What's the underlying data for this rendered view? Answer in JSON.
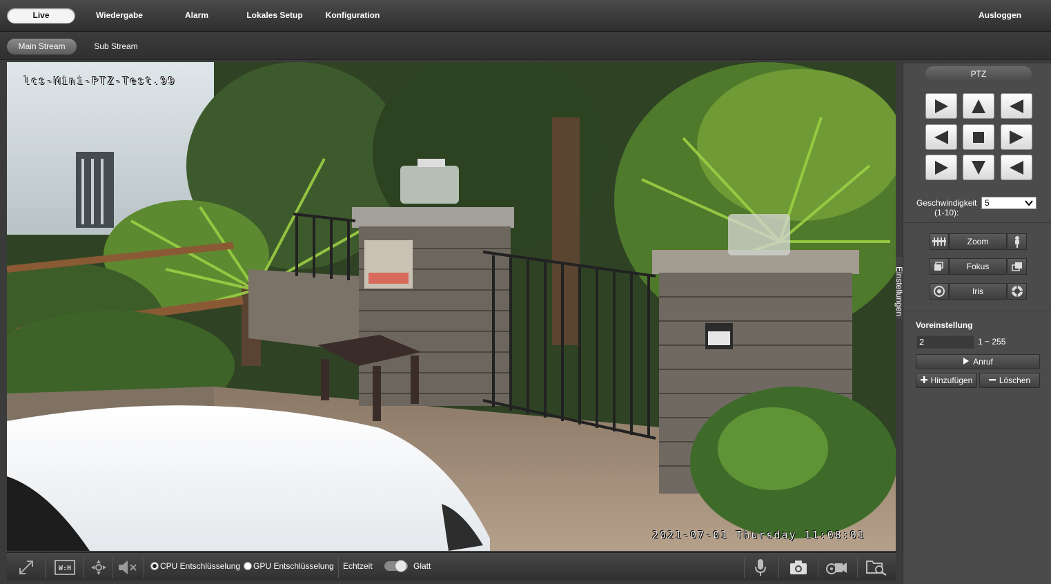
{
  "topnav": {
    "tabs": [
      {
        "label": "Live",
        "active": true
      },
      {
        "label": "Wiedergabe"
      },
      {
        "label": "Alarm"
      },
      {
        "label": "Lokales Setup"
      },
      {
        "label": "Konfiguration"
      }
    ],
    "logout": "Ausloggen"
  },
  "subnav": {
    "tabs": [
      {
        "label": "Main Stream",
        "active": true
      },
      {
        "label": "Sub Stream"
      }
    ]
  },
  "video": {
    "osd_name": "lcs-Mini-PTZ-Test.99",
    "osd_time": "2021-07-01 Thursday 11:08:01"
  },
  "toolbar": {
    "cpu_decode": "CPU Entschlüsselung",
    "gpu_decode": "GPU Entschlüsselung",
    "realtime": "Echtzeit",
    "smooth": "Glatt",
    "decode_selected": "CPU"
  },
  "sidetab": "Einstellungen",
  "ptz": {
    "title": "PTZ",
    "speed_label": "Geschwindigkeit",
    "speed_range": "(1-10):",
    "speed_value": "5",
    "zoom": "Zoom",
    "focus": "Fokus",
    "iris": "Iris",
    "preset_label": "Voreinstellung",
    "preset_value": "2",
    "preset_range": "1 ~ 255",
    "call": "Anruf",
    "add": "Hinzufügen",
    "delete": "Löschen"
  },
  "colors": {
    "background": "#3b3b3b",
    "panel": "#4b4b4b",
    "active_tab": "#f4f4f4"
  }
}
